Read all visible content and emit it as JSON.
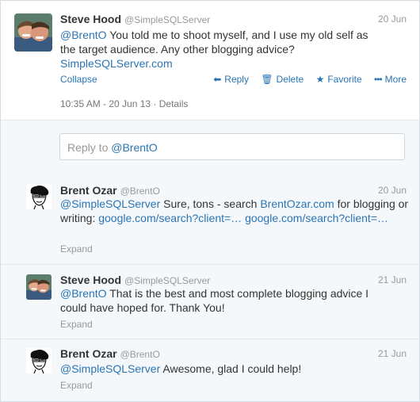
{
  "main_tweet": {
    "name": "Steve Hood",
    "handle": "@SimpleSQLServer",
    "date": "20 Jun",
    "mention": "@BrentO",
    "text": " You told me to shoot myself, and I use my old self as the target audience. Any other blogging advice?",
    "link": "SimpleSQLServer.com",
    "collapse_label": "Collapse",
    "actions": {
      "reply": "Reply",
      "delete": "Delete",
      "favorite": "Favorite",
      "more": "More"
    },
    "timestamp": "10:35 AM - 20 Jun 13",
    "details_label": "Details"
  },
  "reply_box": {
    "prefix": "Reply to ",
    "mention": "@BrentO"
  },
  "replies": [
    {
      "name": "Brent Ozar",
      "handle": "@BrentO",
      "date": "20 Jun",
      "mention": "@SimpleSQLServer",
      "text_1": " Sure, tons - search ",
      "link_1": "BrentOzar.com",
      "text_2": " for blogging or writing: ",
      "link_2": "google.com/search?client=…",
      "link_3": "google.com/search?client=…",
      "expand_label": "Expand"
    },
    {
      "name": "Steve Hood",
      "handle": "@SimpleSQLServer",
      "date": "21 Jun",
      "mention": "@BrentO",
      "text": " That is the best and most complete blogging advice I could have hoped for. Thank You!",
      "expand_label": "Expand"
    },
    {
      "name": "Brent Ozar",
      "handle": "@BrentO",
      "date": "21 Jun",
      "mention": "@SimpleSQLServer",
      "text": " Awesome, glad I could help!",
      "expand_label": "Expand"
    }
  ],
  "colors": {
    "link": "#2a74b5",
    "muted": "#999999",
    "reply_bg": "#f5f8fa",
    "border": "#e1e8ed"
  },
  "icons": [
    "reply-arrow-icon",
    "trash-icon",
    "star-icon",
    "more-dots-icon"
  ]
}
